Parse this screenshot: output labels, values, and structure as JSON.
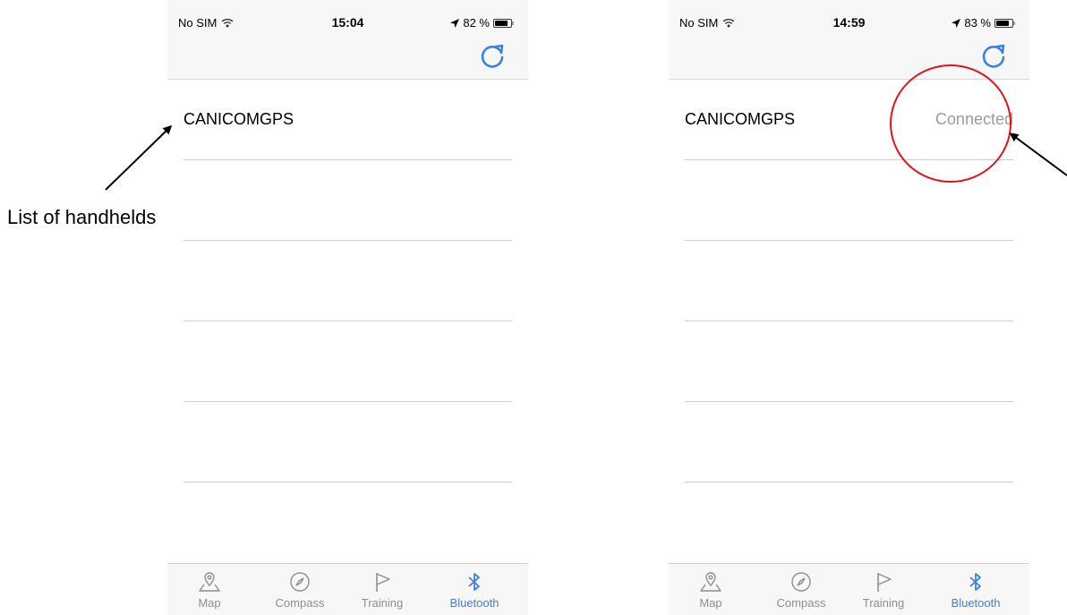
{
  "annotations": {
    "left_label": "List of handhelds",
    "highlight_color": "#e0121b"
  },
  "phones": [
    {
      "status": {
        "carrier": "No SIM",
        "time": "15:04",
        "battery": "82 %",
        "battery_level": 0.82
      },
      "rows": [
        {
          "name": "CANICOMGPS",
          "status": ""
        }
      ],
      "tabs": [
        {
          "label": "Map",
          "icon": "map-pin-icon"
        },
        {
          "label": "Compass",
          "icon": "compass-icon"
        },
        {
          "label": "Training",
          "icon": "flag-icon"
        },
        {
          "label": "Bluetooth",
          "icon": "bluetooth-icon",
          "active": true
        }
      ]
    },
    {
      "status": {
        "carrier": "No SIM",
        "time": "14:59",
        "battery": "83 %",
        "battery_level": 0.83
      },
      "rows": [
        {
          "name": "CANICOMGPS",
          "status": "Connected"
        }
      ],
      "tabs": [
        {
          "label": "Map",
          "icon": "map-pin-icon"
        },
        {
          "label": "Compass",
          "icon": "compass-icon"
        },
        {
          "label": "Training",
          "icon": "flag-icon"
        },
        {
          "label": "Bluetooth",
          "icon": "bluetooth-icon",
          "active": true
        }
      ]
    }
  ],
  "colors": {
    "accent": "#3b82e0",
    "muted": "#8e8e93",
    "status_text": "#9b9b9b"
  }
}
